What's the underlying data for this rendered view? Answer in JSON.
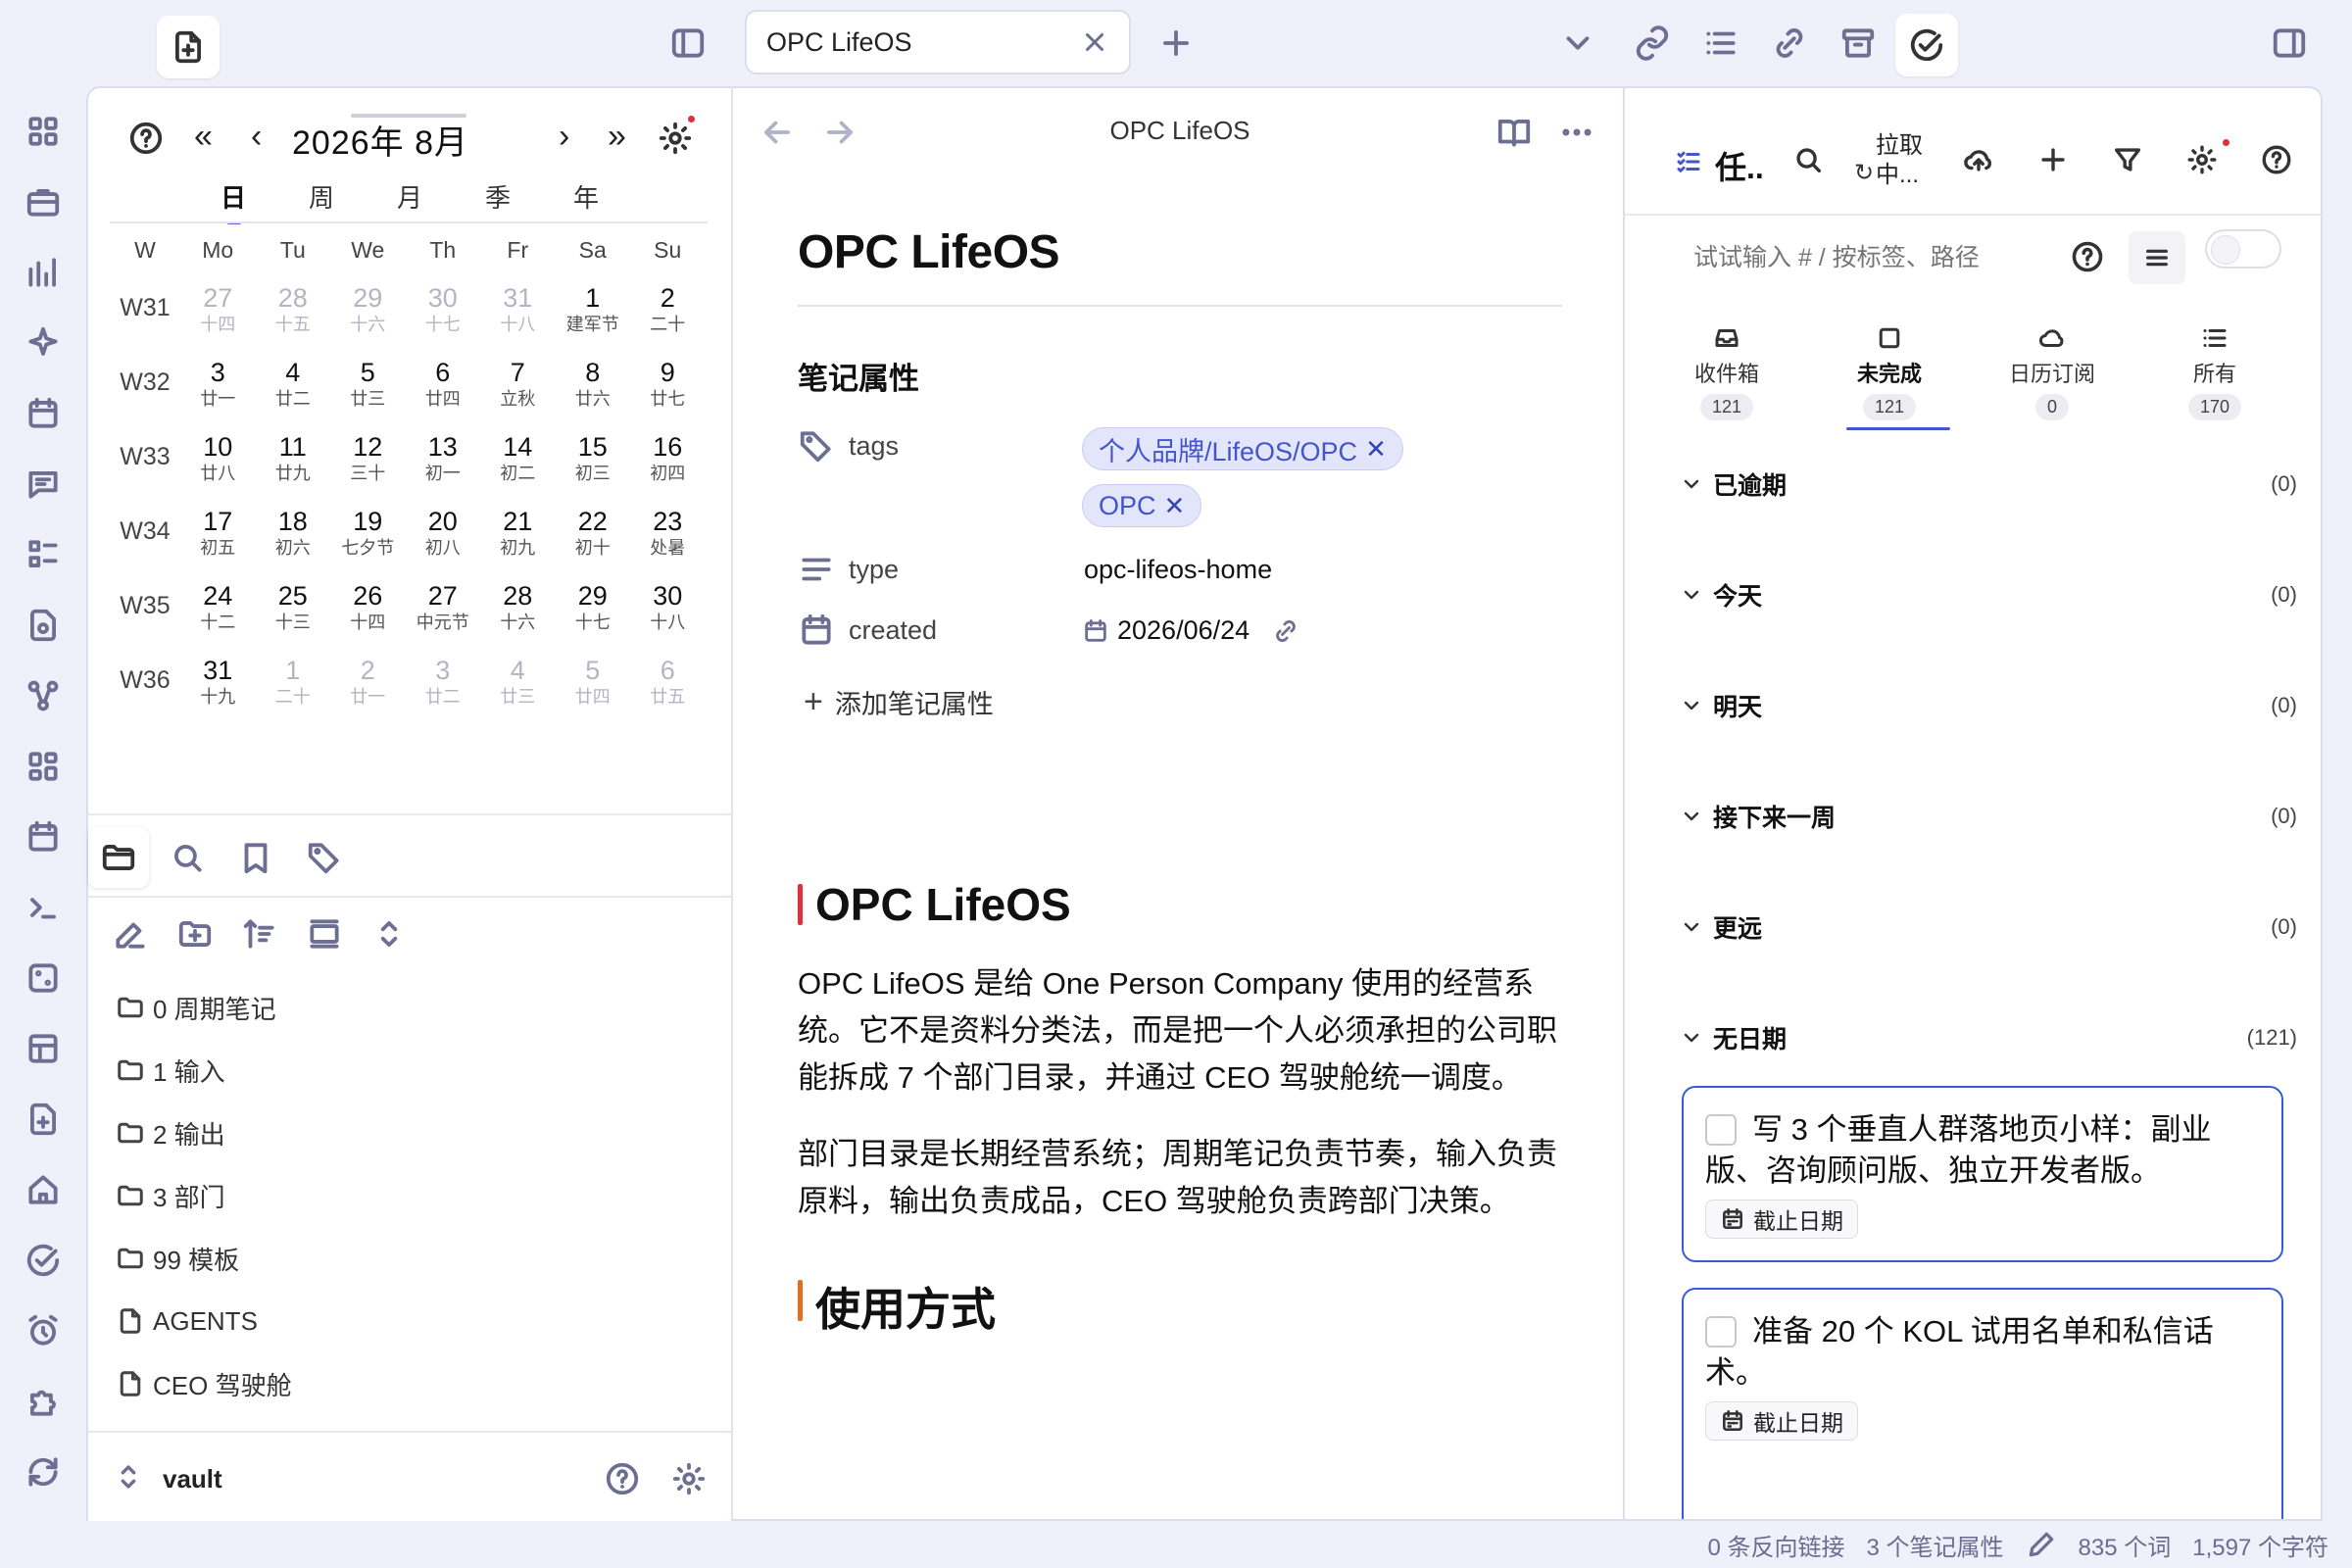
{
  "tab": {
    "title": "OPC LifeOS"
  },
  "calendar": {
    "month": "2026年 8月",
    "views": [
      "日",
      "周",
      "月",
      "季",
      "年"
    ],
    "weekdays": [
      "W",
      "Mo",
      "Tu",
      "We",
      "Th",
      "Fr",
      "Sa",
      "Su"
    ],
    "weeks": [
      {
        "w": "W31",
        "days": [
          [
            "27",
            "十四",
            true
          ],
          [
            "28",
            "十五",
            true
          ],
          [
            "29",
            "十六",
            true
          ],
          [
            "30",
            "十七",
            true
          ],
          [
            "31",
            "十八",
            true
          ],
          [
            "1",
            "建军节",
            false
          ],
          [
            "2",
            "二十",
            false
          ]
        ]
      },
      {
        "w": "W32",
        "days": [
          [
            "3",
            "廿一",
            false
          ],
          [
            "4",
            "廿二",
            false
          ],
          [
            "5",
            "廿三",
            false
          ],
          [
            "6",
            "廿四",
            false
          ],
          [
            "7",
            "立秋",
            false
          ],
          [
            "8",
            "廿六",
            false
          ],
          [
            "9",
            "廿七",
            false
          ]
        ]
      },
      {
        "w": "W33",
        "days": [
          [
            "10",
            "廿八",
            false
          ],
          [
            "11",
            "廿九",
            false
          ],
          [
            "12",
            "三十",
            false
          ],
          [
            "13",
            "初一",
            false
          ],
          [
            "14",
            "初二",
            false
          ],
          [
            "15",
            "初三",
            false
          ],
          [
            "16",
            "初四",
            false
          ]
        ]
      },
      {
        "w": "W34",
        "days": [
          [
            "17",
            "初五",
            false
          ],
          [
            "18",
            "初六",
            false
          ],
          [
            "19",
            "七夕节",
            false
          ],
          [
            "20",
            "初八",
            false
          ],
          [
            "21",
            "初九",
            false
          ],
          [
            "22",
            "初十",
            false
          ],
          [
            "23",
            "处暑",
            false
          ]
        ]
      },
      {
        "w": "W35",
        "days": [
          [
            "24",
            "十二",
            false
          ],
          [
            "25",
            "十三",
            false
          ],
          [
            "26",
            "十四",
            false
          ],
          [
            "27",
            "中元节",
            false
          ],
          [
            "28",
            "十六",
            false
          ],
          [
            "29",
            "十七",
            false
          ],
          [
            "30",
            "十八",
            false
          ]
        ]
      },
      {
        "w": "W36",
        "days": [
          [
            "31",
            "十九",
            false
          ],
          [
            "1",
            "二十",
            true
          ],
          [
            "2",
            "廿一",
            true
          ],
          [
            "3",
            "廿二",
            true
          ],
          [
            "4",
            "廿三",
            true
          ],
          [
            "5",
            "廿四",
            true
          ],
          [
            "6",
            "廿五",
            true
          ]
        ]
      }
    ]
  },
  "files": [
    {
      "type": "folder",
      "name": "0 周期笔记"
    },
    {
      "type": "folder",
      "name": "1 输入"
    },
    {
      "type": "folder",
      "name": "2 输出"
    },
    {
      "type": "folder",
      "name": "3 部门"
    },
    {
      "type": "folder",
      "name": "99 模板"
    },
    {
      "type": "file",
      "name": "AGENTS"
    },
    {
      "type": "file",
      "name": "CEO 驾驶舱"
    }
  ],
  "vault": {
    "name": "vault"
  },
  "note": {
    "header_title": "OPC LifeOS",
    "title": "OPC LifeOS",
    "props_heading": "笔记属性",
    "prop_tags_key": "tags",
    "tags": [
      "个人品牌/LifeOS/OPC",
      "OPC"
    ],
    "prop_type_key": "type",
    "prop_type_val": "opc-lifeos-home",
    "prop_created_key": "created",
    "prop_created_val": "2026/06/24",
    "add_prop": "添加笔记属性",
    "h2_1": "OPC LifeOS",
    "p1": "OPC LifeOS 是给 One Person Company 使用的经营系统。它不是资料分类法，而是把一个人必须承担的公司职能拆成 7 个部门目录，并通过 CEO 驾驶舱统一调度。",
    "p2": "部门目录是长期经营系统；周期笔记负责节奏，输入负责原料，输出负责成品，CEO 驾驶舱负责跨部门决策。",
    "h2_2": "使用方式"
  },
  "tasks": {
    "title": "任..",
    "pull": "拉取中...",
    "search_placeholder": "试试输入 # / 按标签、路径",
    "tabs": [
      {
        "label": "收件箱",
        "count": "121"
      },
      {
        "label": "未完成",
        "count": "121"
      },
      {
        "label": "日历订阅",
        "count": "0"
      },
      {
        "label": "所有",
        "count": "170"
      }
    ],
    "groups": [
      {
        "label": "已逾期",
        "count": "(0)"
      },
      {
        "label": "今天",
        "count": "(0)"
      },
      {
        "label": "明天",
        "count": "(0)"
      },
      {
        "label": "接下来一周",
        "count": "(0)"
      },
      {
        "label": "更远",
        "count": "(0)"
      },
      {
        "label": "无日期",
        "count": "(121)"
      }
    ],
    "items": [
      {
        "text": "写 3 个垂直人群落地页小样：副业版、咨询顾问版、独立开发者版。",
        "due": "截止日期"
      },
      {
        "text": "准备 20 个 KOL 试用名单和私信话术。",
        "due": "截止日期"
      }
    ]
  },
  "status": {
    "backlinks": "0 条反向链接",
    "props": "3 个笔记属性",
    "words": "835 个词",
    "chars": "1,597 个字符"
  },
  "colors": {
    "accent": "#4455cc",
    "task_border": "#3a5ad8",
    "h2_red": "#e03040",
    "h2_orange": "#e07020"
  }
}
